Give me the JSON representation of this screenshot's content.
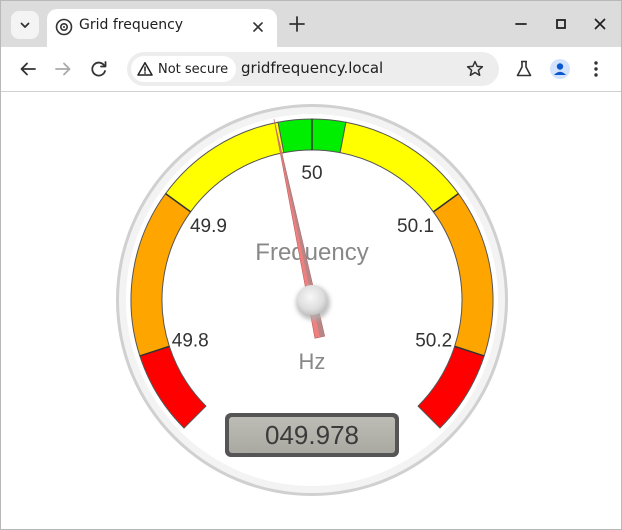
{
  "browser": {
    "tab_title": "Grid frequency",
    "security_label": "Not secure",
    "url": "gridfrequency.local"
  },
  "gauge": {
    "title": "Frequency",
    "units": "Hz",
    "display_value": "049.978",
    "value": 49.978,
    "min_value": 49.75,
    "max_value": 50.25,
    "tick_labels": [
      "49.8",
      "49.9",
      "50",
      "50.1",
      "50.2"
    ],
    "tick_values": [
      49.8,
      49.9,
      50.0,
      50.1,
      50.2
    ],
    "zones": [
      {
        "from": 49.75,
        "to": 49.8,
        "color": "#ff0000"
      },
      {
        "from": 49.8,
        "to": 49.9,
        "color": "#ffa500"
      },
      {
        "from": 49.9,
        "to": 49.98,
        "color": "#ffff00"
      },
      {
        "from": 49.98,
        "to": 50.02,
        "color": "#00ee00"
      },
      {
        "from": 50.02,
        "to": 50.1,
        "color": "#ffff00"
      },
      {
        "from": 50.1,
        "to": 50.2,
        "color": "#ffa500"
      },
      {
        "from": 50.2,
        "to": 50.25,
        "color": "#ff0000"
      }
    ],
    "needle_color": "#f08080",
    "label_color": "#888888"
  }
}
